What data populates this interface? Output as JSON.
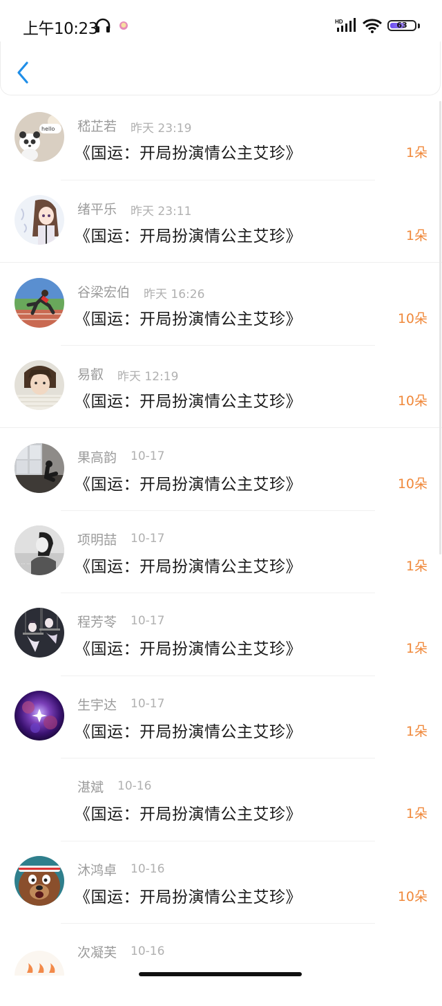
{
  "status_bar": {
    "time": "上午10:23",
    "network": "HD",
    "battery": "63",
    "battery_level": 0.63
  },
  "nav": {
    "back_icon": "chevron-left-icon"
  },
  "colors": {
    "accent": "#1f8ee8",
    "amount": "#f0883a"
  },
  "gifts": [
    {
      "name": "嵇芷若",
      "time": "昨天 23:19",
      "book": "《国运：开局扮演情公主艾珍》",
      "amount": "1朵",
      "avatar": "panda-hello"
    },
    {
      "name": "绪平乐",
      "time": "昨天 23:11",
      "book": "《国运：开局扮演情公主艾珍》",
      "amount": "1朵",
      "avatar": "anime-girl"
    },
    {
      "name": "谷梁宏伯",
      "time": "昨天 16:26",
      "book": "《国运：开局扮演情公主艾珍》",
      "amount": "10朵",
      "avatar": "runner"
    },
    {
      "name": "易叡",
      "time": "昨天 12:19",
      "book": "《国运：开局扮演情公主艾珍》",
      "amount": "10朵",
      "avatar": "boy-portrait"
    },
    {
      "name": "果高韵",
      "time": "10-17",
      "book": "《国运：开局扮演情公主艾珍》",
      "amount": "10朵",
      "avatar": "window-sitter"
    },
    {
      "name": "项明喆",
      "time": "10-17",
      "book": "《国运：开局扮演情公主艾珍》",
      "amount": "1朵",
      "avatar": "bw-girl"
    },
    {
      "name": "程芳苓",
      "time": "10-17",
      "book": "《国运：开局扮演情公主艾珍》",
      "amount": "1朵",
      "avatar": "anime-swing"
    },
    {
      "name": "生宇达",
      "time": "10-17",
      "book": "《国运：开局扮演情公主艾珍》",
      "amount": "1朵",
      "avatar": "galaxy"
    },
    {
      "name": "湛斌",
      "time": "10-16",
      "book": "《国运：开局扮演情公主艾珍》",
      "amount": "1朵",
      "avatar": "none"
    },
    {
      "name": "沐鸿卓",
      "time": "10-16",
      "book": "《国运：开局扮演情公主艾珍》",
      "amount": "10朵",
      "avatar": "bear"
    },
    {
      "name": "次凝芙",
      "time": "10-16",
      "book": "",
      "amount": "",
      "avatar": "flames"
    }
  ]
}
